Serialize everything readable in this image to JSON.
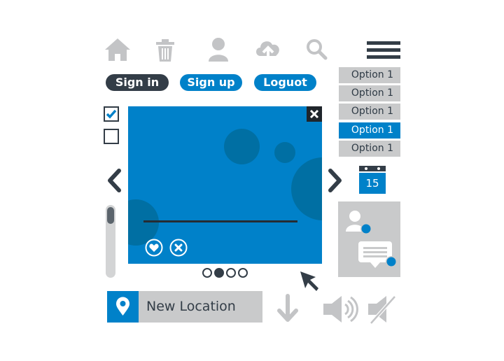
{
  "toolbar": {
    "icons": [
      "home-icon",
      "trash-icon",
      "user-icon",
      "cloud-upload-icon",
      "search-icon",
      "menu-icon"
    ]
  },
  "auth": {
    "signin_label": "Sign in",
    "signup_label": "Sign up",
    "logout_label": "Loguot"
  },
  "dropdown": {
    "options": [
      "Option 1",
      "Option 1",
      "Option 1",
      "Option 1",
      "Option 1"
    ],
    "selected_index": 3
  },
  "checkboxes": [
    {
      "checked": true
    },
    {
      "checked": false
    }
  ],
  "calendar": {
    "day": "15"
  },
  "carousel": {
    "page_count": 4,
    "active_page": 2
  },
  "location": {
    "label": "New Location"
  },
  "colors": {
    "primary": "#0081c9",
    "dark": "#333d47",
    "gray": "#c9cacb"
  }
}
